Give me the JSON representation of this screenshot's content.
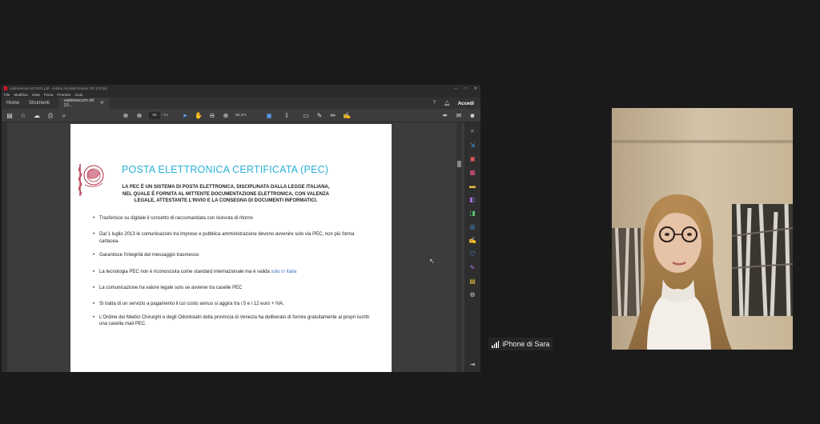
{
  "acrobat": {
    "title": "vademecum ott 2021.pdf - Adobe Acrobat Reader DC (32-bit)",
    "menu": [
      "File",
      "Modifica",
      "Vista",
      "Firma",
      "Finestra",
      "Aiuto"
    ],
    "tabs": {
      "home": "Home",
      "tools": "Strumenti",
      "document": "vademecum ott 20..."
    },
    "sign_in": "Accedi",
    "page_current": "55",
    "page_total": "/ 64",
    "zoom": "85,3%"
  },
  "slide": {
    "title": "POSTA ELETTRONICA CERTIFICATA (PEC)",
    "subtitle": "LA PEC È UN SISTEMA DI POSTA ELETTRONICA, DISCIPLINATA DALLA LEGGE ITALIANA, NEL QUALE È FORNITA AL MITTENTE DOCUMENTAZIONE ELETTRONICA, CON VALENZA LEGALE, ATTESTANTE L'INVIO E LA CONSEGNA DI DOCUMENTI INFORMATICI.",
    "bullets": [
      "Trasferisce su digitale il concetto di raccomandata con ricevuta di ritorno",
      "Dal 1 luglio 2013 le comunicazioni tra imprese e pubblica amministrazione devono avvenire solo via PEC, non più forma cartacea.",
      "Garantisce l'integrità del messaggio trasmesso",
      "La tecnologia PEC non è riconosciuta come standard internazionale ma è valida ",
      "La comunicazione ha valore legale solo se avviene tra caselle PEC",
      "Si tratta di un servizio a pagamento il cui costo annuo si aggira tra i 5 e i 12 euro + IVA.",
      "L'Ordine dei Medici Chirurghi e degli Odontoiatri della provincia di Venezia ha deliberato di fornire gratuitamente ai propri iscritti una casella mail PEC."
    ],
    "highlight": "solo in Italia"
  },
  "participant": {
    "name": "iPhone di Sara"
  },
  "colors": {
    "title_blue": "#2bb0d8",
    "link_blue": "#3e6fc4",
    "bg": "#1a1a1a"
  }
}
